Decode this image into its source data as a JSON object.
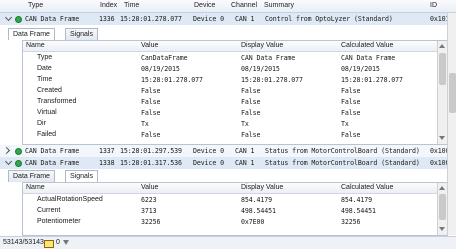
{
  "columns": {
    "type": "Type",
    "index": "Index",
    "time": "Time",
    "device": "Device",
    "channel": "Channel",
    "summary": "Summary",
    "id": "ID"
  },
  "messages": [
    {
      "type": "CAN Data Frame",
      "index": "1336",
      "time": "15:28:01.278.077",
      "device": "Device 0",
      "channel": "CAN 1",
      "summary": "Control from OptoLyzer (Standard)",
      "id": "0x101"
    },
    {
      "type": "CAN Data Frame",
      "index": "1337",
      "time": "15:28:01.297.539",
      "device": "Device 0",
      "channel": "CAN 1",
      "summary": "Status from MotorControlBoard (Standard)",
      "id": "0x100"
    },
    {
      "type": "CAN Data Frame",
      "index": "1338",
      "time": "15:28:01.317.536",
      "device": "Device 0",
      "channel": "CAN 1",
      "summary": "Status from MotorControlBoard (Standard)",
      "id": "0x100"
    }
  ],
  "detail1": {
    "tabs": [
      "Data Frame",
      "Signals"
    ],
    "headers": {
      "name": "Name",
      "value": "Value",
      "display": "Display Value",
      "calculated": "Calculated Value"
    },
    "rows": [
      {
        "name": "Type",
        "value": "CanDataFrame",
        "display": "CAN Data Frame",
        "calculated": "CAN Data Frame"
      },
      {
        "name": "Date",
        "value": "08/19/2015",
        "display": "08/19/2015",
        "calculated": "08/19/2015"
      },
      {
        "name": "Time",
        "value": "15:28:01.278.077",
        "display": "15:28:01.278.077",
        "calculated": "15:28:01.278.077"
      },
      {
        "name": "Created",
        "value": "False",
        "display": "False",
        "calculated": "False"
      },
      {
        "name": "Transformed",
        "value": "False",
        "display": "False",
        "calculated": "False"
      },
      {
        "name": "Virtual",
        "value": "False",
        "display": "False",
        "calculated": "False"
      },
      {
        "name": "Dir",
        "value": "Tx",
        "display": "Tx",
        "calculated": "Tx"
      },
      {
        "name": "Failed",
        "value": "False",
        "display": "False",
        "calculated": "False"
      }
    ]
  },
  "detail2": {
    "tabs": [
      "Data Frame",
      "Signals"
    ],
    "headers": {
      "name": "Name",
      "value": "Value",
      "display": "Display Value",
      "calculated": "Calculated Value"
    },
    "rows": [
      {
        "name": "ActualRotationSpeed",
        "value": "6223",
        "display": "854.4179",
        "calculated": "854.4179"
      },
      {
        "name": "Current",
        "value": "3713",
        "display": "498.54451",
        "calculated": "498.54451"
      },
      {
        "name": "Potentiometer",
        "value": "32256",
        "display": "0x7E00",
        "calculated": "32256"
      }
    ]
  },
  "status": {
    "count": "53143/53143",
    "flag": "0"
  },
  "icons": {
    "dot": "status-dot-icon",
    "expander": "expander-icon",
    "mail": "mail-icon",
    "filter": "filter-icon"
  },
  "colors": {
    "selection": "#dfe9f6",
    "status_ok": "#2ea84a"
  }
}
